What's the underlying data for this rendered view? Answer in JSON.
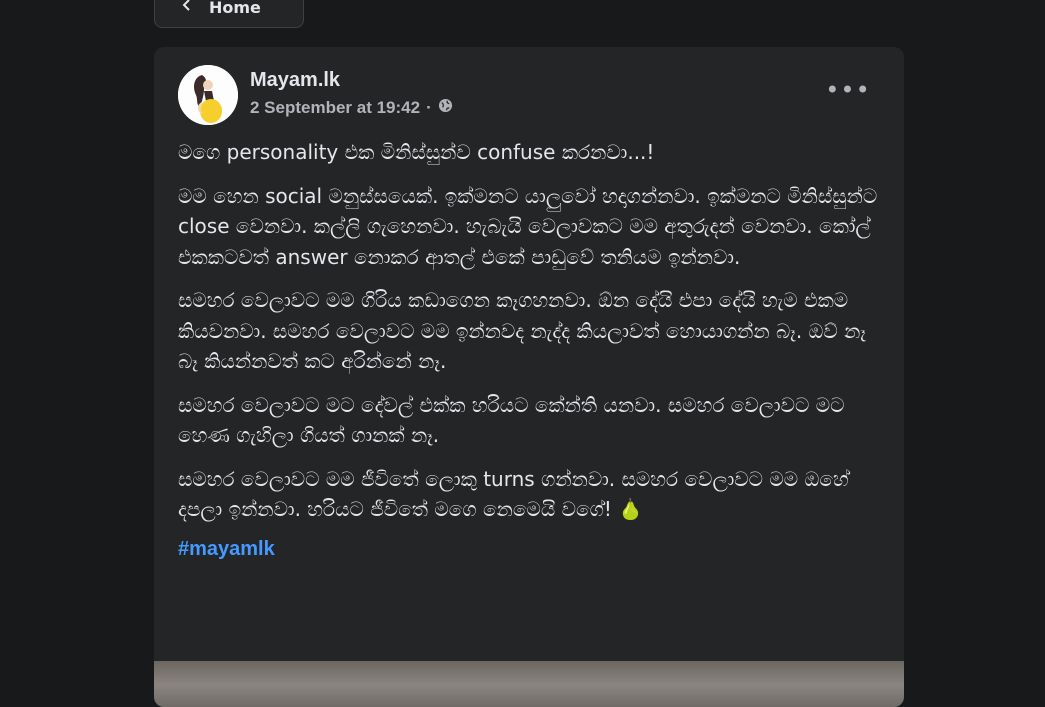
{
  "nav": {
    "home_label": "Home"
  },
  "post": {
    "author": "Mayam.lk",
    "date": "2 September at 19:42",
    "separator": "·",
    "paragraphs": [
      "මගෙ personality එක මිනිස්සුන්ව confuse කරනවා...!",
      "මම හෙන social මනුස්සයෙක්. ඉක්මනට යාලුවෝ හදාගන්නවා. ඉක්මනට මිනිස්සුන්ට close වෙනවා. කල්ලි ගැහෙනවා. හැබැයි වෙලාවකට මම අතුරුදන් වෙනවා. කෝල් එකකටවත් answer නොකර ආතල් එකේ පාඩුවේ තනියම ඉන්නවා.",
      "සමහර වෙලාවට මම ගිරිය කඩාගෙන කෑගහනවා. ඕන දේයි එපා දේයි හැම එකම කියවනවා. සමහර වෙලාවට මම ඉන්නවද නැද්ද කියලාවත් හොයාගන්න බෑ. ඔව් නෑ බෑ කියන්නවත් කට අරින්නේ නෑ.",
      "සමහර වෙලාවට මට දේවල් එක්ක හරියට කේන්ති යනවා. සමහර වෙලාවට මට හෙණ ගැහිලා ගියත් ගානක් නෑ.",
      "සමහර වෙලාවට මම ජීවිතේ ලොකු turns ගන්නවා. සමහර වෙලාවට මම ඔහේ දපලා ඉන්නවා. හරියට ජීවිතේ මගෙ නෙමෙයි වගේ!"
    ],
    "emoji": "🍐",
    "hashtag": "#mayamlk",
    "more_label": "•••"
  },
  "icons": {
    "back": "arrow-left-icon",
    "audience": "globe-icon",
    "more": "more-horizontal-icon"
  },
  "colors": {
    "background": "#18191a",
    "card": "#242526",
    "text": "#e4e6eb",
    "secondary_text": "#b0b3b8",
    "link": "#4599ff"
  }
}
